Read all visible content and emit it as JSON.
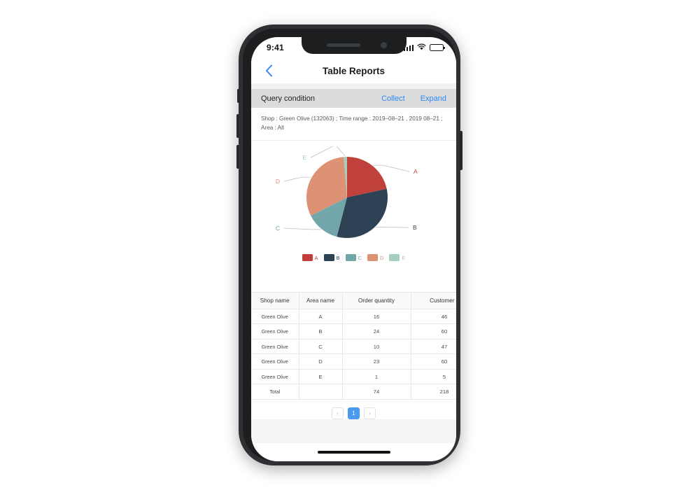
{
  "status_bar": {
    "time": "9:41",
    "signal_icon": "cellular-signal-icon",
    "wifi_icon": "wifi-icon",
    "battery_icon": "battery-icon"
  },
  "nav": {
    "back_icon": "chevron-left-icon",
    "title": "Table Reports"
  },
  "query": {
    "label": "Query condition",
    "collect_label": "Collect",
    "expand_label": "Expand",
    "detail": "Shop : Green Olive (132063) ; Time range : 2019–08–21 , 2019 08–21 ; Area : All"
  },
  "colors": {
    "slice_a": "#c0403b",
    "slice_b": "#2d4355",
    "slice_c": "#72a6ab",
    "slice_d": "#dd9276",
    "slice_e": "#a7cdbd",
    "accent_blue": "#2f86f6",
    "page_active": "#4a9bf0",
    "query_bar_bg": "#dcdcdc"
  },
  "chart_data": {
    "type": "pie",
    "title": "",
    "labels": [
      "A",
      "B",
      "C",
      "D",
      "E"
    ],
    "values": [
      16,
      24,
      10,
      23,
      1
    ],
    "total": 74,
    "colors": [
      "#c0403b",
      "#2d4355",
      "#72a6ab",
      "#dd9276",
      "#a7cdbd"
    ],
    "legend": [
      "A",
      "B",
      "C",
      "D",
      "E"
    ],
    "legend_position": "bottom",
    "annotations": [
      {
        "label": "A",
        "leader_line": true
      },
      {
        "label": "B",
        "leader_line": true
      },
      {
        "label": "C",
        "leader_line": true
      },
      {
        "label": "D",
        "leader_line": true
      },
      {
        "label": "E",
        "leader_line": true
      }
    ]
  },
  "table": {
    "headers": [
      "Shop name",
      "Area name",
      "Order quantity",
      "Customer fl"
    ],
    "rows": [
      {
        "shop": "Green Olive",
        "area": "A",
        "qty": "16",
        "flow": "46"
      },
      {
        "shop": "Green Olive",
        "area": "B",
        "qty": "24",
        "flow": "60"
      },
      {
        "shop": "Green Olive",
        "area": "C",
        "qty": "10",
        "flow": "47"
      },
      {
        "shop": "Green Olive",
        "area": "D",
        "qty": "23",
        "flow": "60"
      },
      {
        "shop": "Green Olive",
        "area": "E",
        "qty": "1",
        "flow": "5"
      },
      {
        "shop": "Total",
        "area": "",
        "qty": "74",
        "flow": "218"
      }
    ]
  },
  "pagination": {
    "prev_label": "‹",
    "page_label": "1",
    "next_label": "›"
  }
}
